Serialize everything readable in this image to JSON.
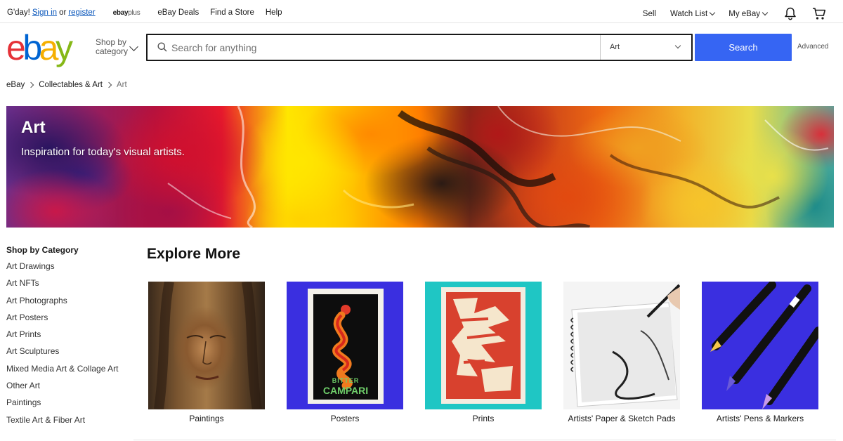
{
  "topbar": {
    "greeting": "G'day!",
    "sign_in": "Sign in",
    "or": "or",
    "register": "register",
    "ebayplus_brand": "ebay",
    "ebayplus_suffix": "plus",
    "deals": "eBay Deals",
    "find_store": "Find a Store",
    "help": "Help",
    "sell": "Sell",
    "watch_list": "Watch List",
    "my_ebay": "My eBay"
  },
  "header": {
    "logo_letters": [
      "e",
      "b",
      "a",
      "y"
    ],
    "shop_by_line1": "Shop by",
    "shop_by_line2": "category",
    "search_placeholder": "Search for anything",
    "category_value": "Art",
    "search_button": "Search",
    "advanced": "Advanced"
  },
  "breadcrumb": {
    "items": [
      "eBay",
      "Collectables & Art",
      "Art"
    ]
  },
  "hero": {
    "title": "Art",
    "subtitle": "Inspiration for today's visual artists."
  },
  "sidebar": {
    "heading": "Shop by Category",
    "items": [
      "Art Drawings",
      "Art NFTs",
      "Art Photographs",
      "Art Posters",
      "Art Prints",
      "Art Sculptures",
      "Mixed Media Art & Collage Art",
      "Other Art",
      "Paintings",
      "Textile Art & Fiber Art"
    ]
  },
  "explore": {
    "title": "Explore More",
    "cards": [
      {
        "label": "Paintings"
      },
      {
        "label": "Posters",
        "poster_text_1": "BITTER",
        "poster_text_2": "CAMPARI"
      },
      {
        "label": "Prints"
      },
      {
        "label": "Artists' Paper & Sketch Pads"
      },
      {
        "label": "Artists' Pens & Markers"
      }
    ]
  },
  "colors": {
    "search_button": "#3665f3",
    "link_blue": "#0654ba",
    "logo_e": "#e53238",
    "logo_b": "#0064d2",
    "logo_a": "#f5af02",
    "logo_y": "#86b817",
    "posters_bg": "#3a2fe0",
    "prints_bg": "#1fc6c4",
    "pens_bg": "#3a2fe0"
  },
  "icons": {
    "search": "search-icon",
    "bell": "bell-icon",
    "cart": "cart-icon"
  }
}
